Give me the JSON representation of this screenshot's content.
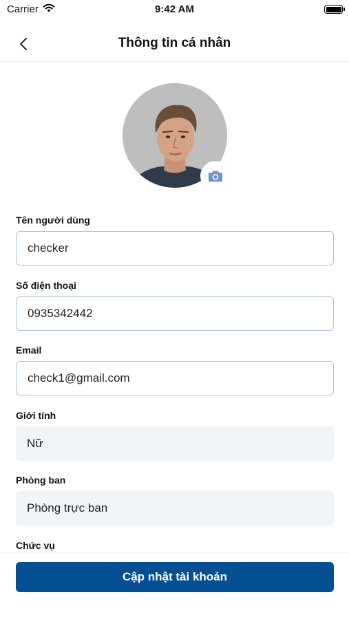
{
  "status_bar": {
    "carrier": "Carrier",
    "time": "9:42 AM",
    "wifi_icon": "wifi-icon",
    "battery_icon": "battery-icon"
  },
  "nav": {
    "back_icon": "chevron-left-icon",
    "title": "Thông tin cá nhân"
  },
  "profile": {
    "avatar": "user-photo",
    "camera_icon": "camera-icon",
    "camera_color": "#6f93c2"
  },
  "form": {
    "username": {
      "label": "Tên người dùng",
      "value": "checker"
    },
    "phone": {
      "label": "Số điện thoại",
      "value": "0935342442"
    },
    "email": {
      "label": "Email",
      "value": "check1@gmail.com"
    },
    "gender": {
      "label": "Giới tính",
      "value": "Nữ"
    },
    "department": {
      "label": "Phòng ban",
      "value": "Phòng trực ban"
    },
    "position": {
      "label": "Chức vụ"
    }
  },
  "footer": {
    "update_button": "Cập nhật tài khoản"
  },
  "colors": {
    "primary": "#064f93",
    "input_border": "#a9c2e1",
    "readonly_bg": "#f2f5f8"
  }
}
